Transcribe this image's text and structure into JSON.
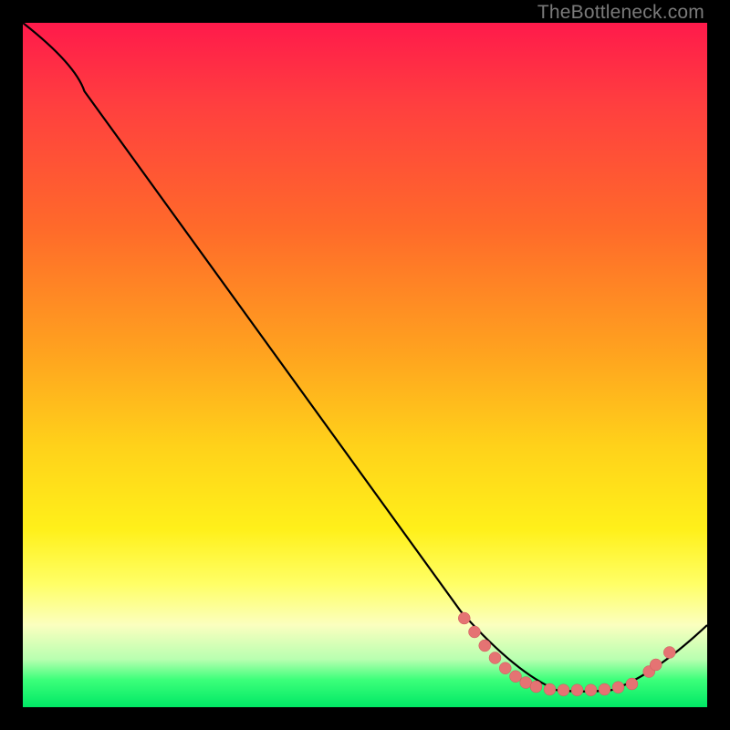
{
  "attribution": "TheBottleneck.com",
  "colors": {
    "curve_stroke": "#000000",
    "marker_fill": "#e57373",
    "marker_stroke": "#cc5a5a"
  },
  "chart_data": {
    "type": "line",
    "title": "",
    "xlabel": "",
    "ylabel": "",
    "xlim": [
      0,
      100
    ],
    "ylim": [
      0,
      100
    ],
    "curve": [
      {
        "x": 0,
        "y": 100
      },
      {
        "x": 9,
        "y": 90
      },
      {
        "x": 64,
        "y": 14
      },
      {
        "x": 72,
        "y": 5
      },
      {
        "x": 78,
        "y": 2.5
      },
      {
        "x": 86,
        "y": 2.5
      },
      {
        "x": 92,
        "y": 4.5
      },
      {
        "x": 100,
        "y": 12
      }
    ],
    "markers": [
      {
        "x": 64.5,
        "y": 13.0
      },
      {
        "x": 66.0,
        "y": 11.0
      },
      {
        "x": 67.5,
        "y": 9.0
      },
      {
        "x": 69.0,
        "y": 7.2
      },
      {
        "x": 70.5,
        "y": 5.7
      },
      {
        "x": 72.0,
        "y": 4.5
      },
      {
        "x": 73.5,
        "y": 3.6
      },
      {
        "x": 75.0,
        "y": 3.0
      },
      {
        "x": 77.0,
        "y": 2.6
      },
      {
        "x": 79.0,
        "y": 2.5
      },
      {
        "x": 81.0,
        "y": 2.5
      },
      {
        "x": 83.0,
        "y": 2.5
      },
      {
        "x": 85.0,
        "y": 2.6
      },
      {
        "x": 87.0,
        "y": 2.9
      },
      {
        "x": 89.0,
        "y": 3.4
      },
      {
        "x": 91.5,
        "y": 5.2
      },
      {
        "x": 92.5,
        "y": 6.2
      },
      {
        "x": 94.5,
        "y": 8.0
      }
    ]
  }
}
